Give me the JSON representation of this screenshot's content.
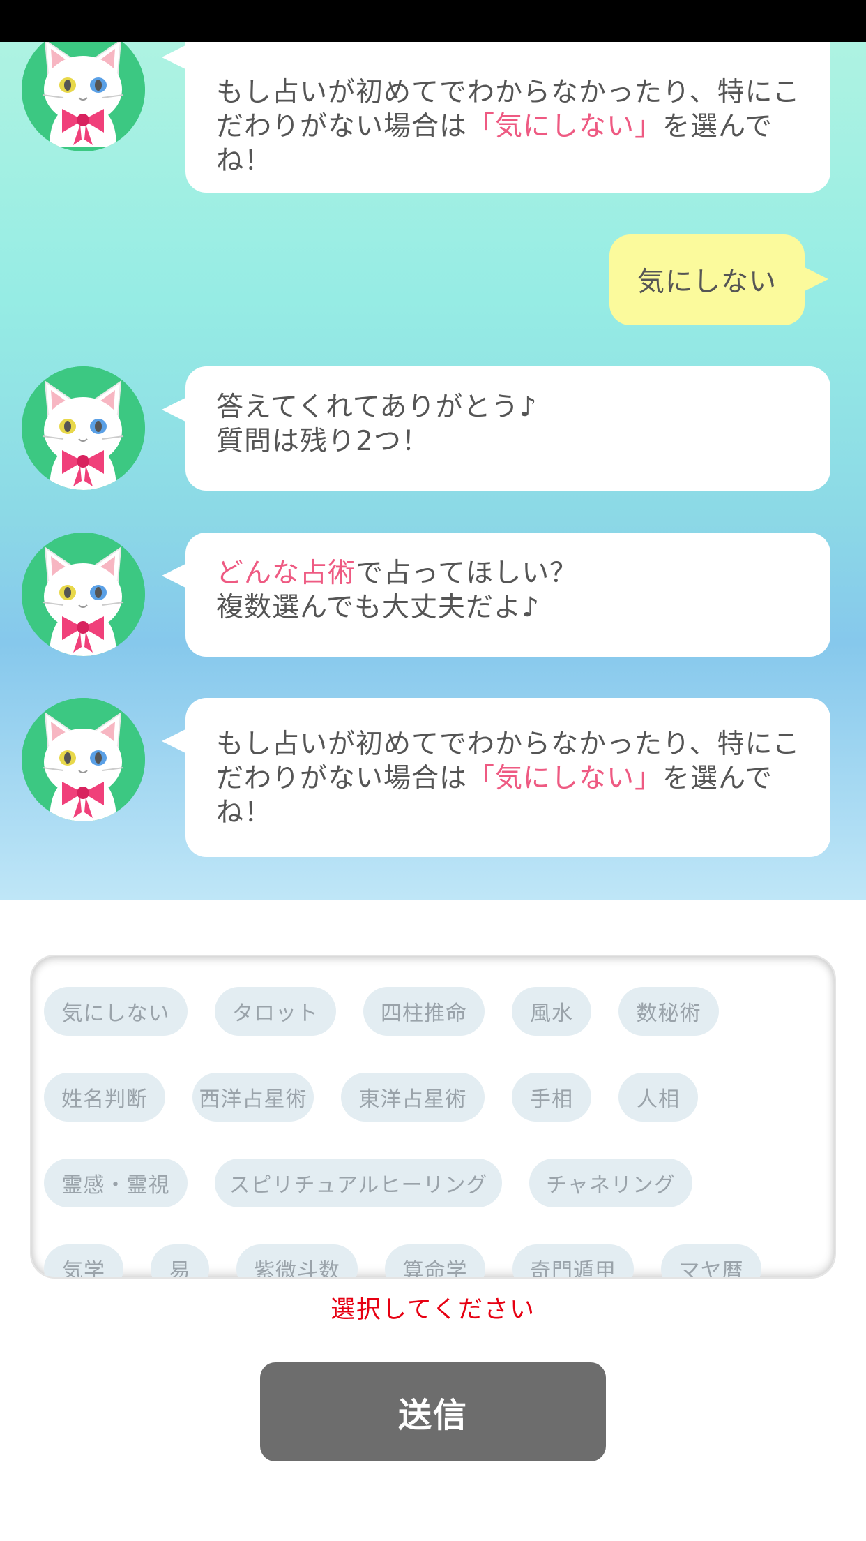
{
  "chat": {
    "messages": [
      {
        "pre": "もし占いが初めてでわからなかったり、特にこだわりがない場合は",
        "highlight": "「気にしない」",
        "post": "を選んでね！"
      },
      {
        "line1": "答えてくれてありがとう♪",
        "line2": "質問は残り2つ！"
      },
      {
        "highlight": "どんな占術",
        "post1": "で占ってほしい？",
        "line2": "複数選んでも大丈夫だよ♪"
      },
      {
        "pre": "もし占いが初めてでわからなかったり、特にこだわりがない場合は",
        "highlight": "「気にしない」",
        "post": "を選んでね！"
      }
    ],
    "user_reply": "気にしない"
  },
  "options": {
    "row1": [
      "気にしない",
      "タロット",
      "四柱推命",
      "風水",
      "数秘術"
    ],
    "row2": [
      "姓名判断",
      "西洋占星術",
      "東洋占星術",
      "手相",
      "人相"
    ],
    "row3": [
      "霊感・霊視",
      "スピリチュアルヒーリング",
      "チャネリング"
    ],
    "row4": [
      "気学",
      "易",
      "紫微斗数",
      "算命学",
      "奇門遁甲",
      "マヤ暦"
    ]
  },
  "hint": "選択してください",
  "send_label": "送信",
  "colors": {
    "accent_pink": "#ee5a82",
    "user_bubble": "#fbfa9c",
    "avatar_bg": "#3cc882",
    "chip_bg": "#e3edf2",
    "error_text": "#e60012",
    "send_button": "#6d6d6d"
  }
}
